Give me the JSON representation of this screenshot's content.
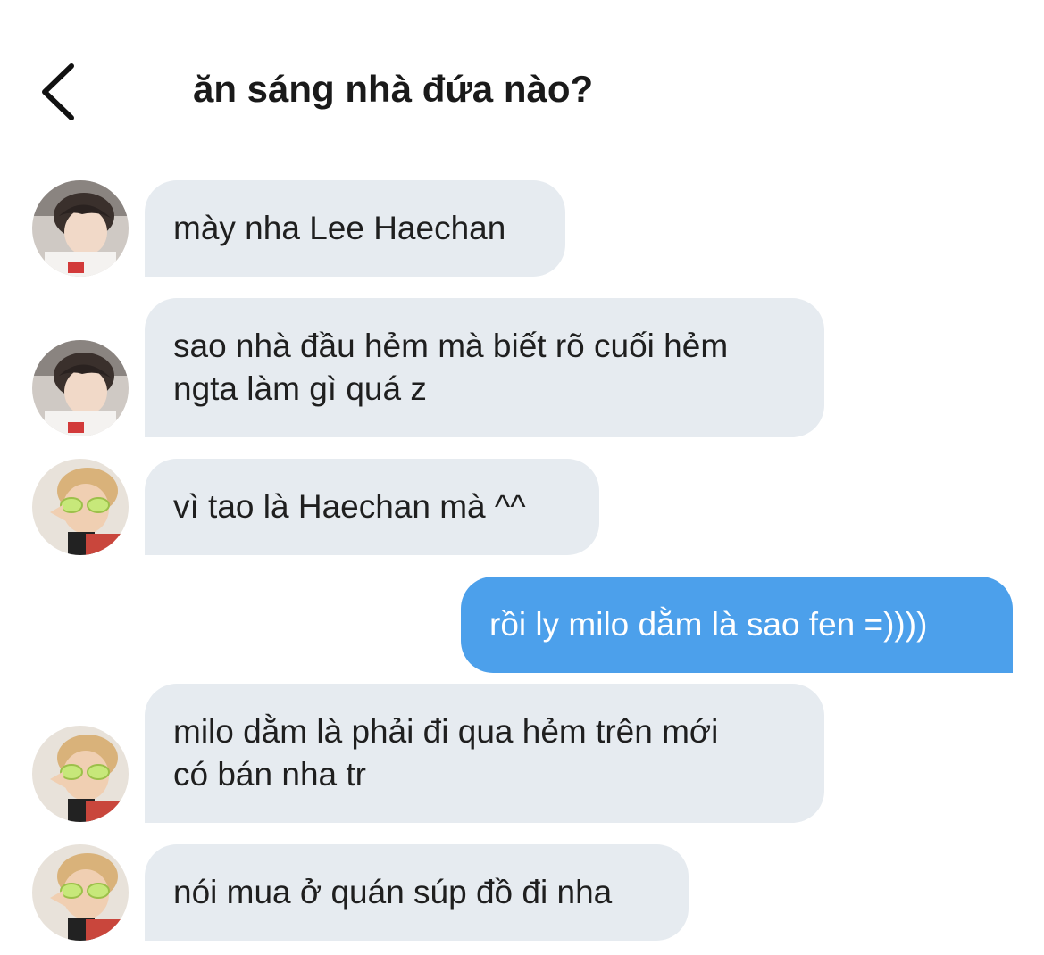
{
  "header": {
    "title": "ăn sáng nhà đứa nào?"
  },
  "colors": {
    "incoming_bubble": "#e6ebf0",
    "outgoing_bubble": "#4ca0eb"
  },
  "messages": [
    {
      "sender": "other",
      "avatar": "avatar-icon",
      "text": "mày nha Lee Haechan"
    },
    {
      "sender": "other",
      "avatar": "avatar-icon",
      "text": "sao nhà đầu hẻm mà biết rõ cuối hẻm\nngta làm gì quá z"
    },
    {
      "sender": "other",
      "avatar": "avatar-icon",
      "text": "vì tao là Haechan mà ^^"
    },
    {
      "sender": "me",
      "text": "rồi ly milo dằm là sao fen =))))"
    },
    {
      "sender": "other",
      "avatar": "avatar-icon",
      "text": "milo dằm là phải đi qua hẻm trên mới\ncó bán nha tr"
    },
    {
      "sender": "other",
      "avatar": "avatar-icon",
      "text": "nói mua ở quán súp đồ đi nha"
    }
  ]
}
